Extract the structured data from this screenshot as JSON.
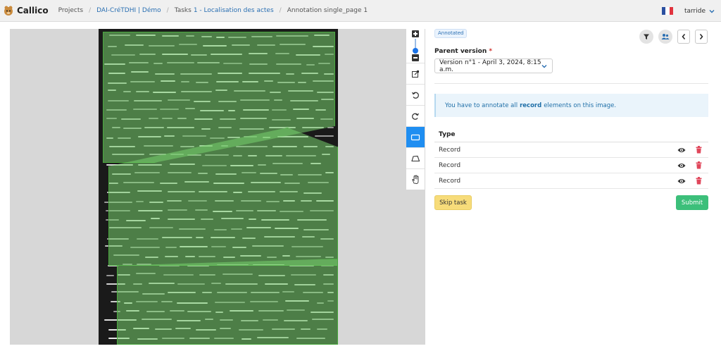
{
  "navbar": {
    "brand": "Callico",
    "breadcrumbs": [
      {
        "label": "Projects",
        "link": false
      },
      {
        "label": "DAI-CréTDHI | Démo",
        "link": true
      },
      {
        "label": "Tasks",
        "link": false
      },
      {
        "label": "1 - Localisation des actes",
        "link": true
      },
      {
        "label": "Annotation single_page 1",
        "link": false
      }
    ],
    "user": "tarride"
  },
  "viewer": {
    "tools": [
      "edit-icon",
      "rotate-left-icon",
      "rotate-right-icon",
      "rectangle-icon",
      "polygon-icon",
      "hand-icon"
    ],
    "active_tool": "rectangle-icon"
  },
  "panel": {
    "badge": "Annotated",
    "parent_version_label": "Parent version",
    "required_mark": "*",
    "parent_version_value": "Version n°1 - April 3, 2024, 8:15 a.m.",
    "info_before": "You have to annotate all",
    "info_strong": "record",
    "info_after": "elements on this image.",
    "table_header": "Type",
    "rows": [
      {
        "type": "Record"
      },
      {
        "type": "Record"
      },
      {
        "type": "Record"
      }
    ],
    "skip_label": "Skip task",
    "submit_label": "Submit"
  },
  "colors": {
    "accent": "#1f8ef1",
    "zone_fill": "#78d26e",
    "submit": "#3cbf7a",
    "skip": "#f7dc7a",
    "delete": "#e0475b"
  }
}
